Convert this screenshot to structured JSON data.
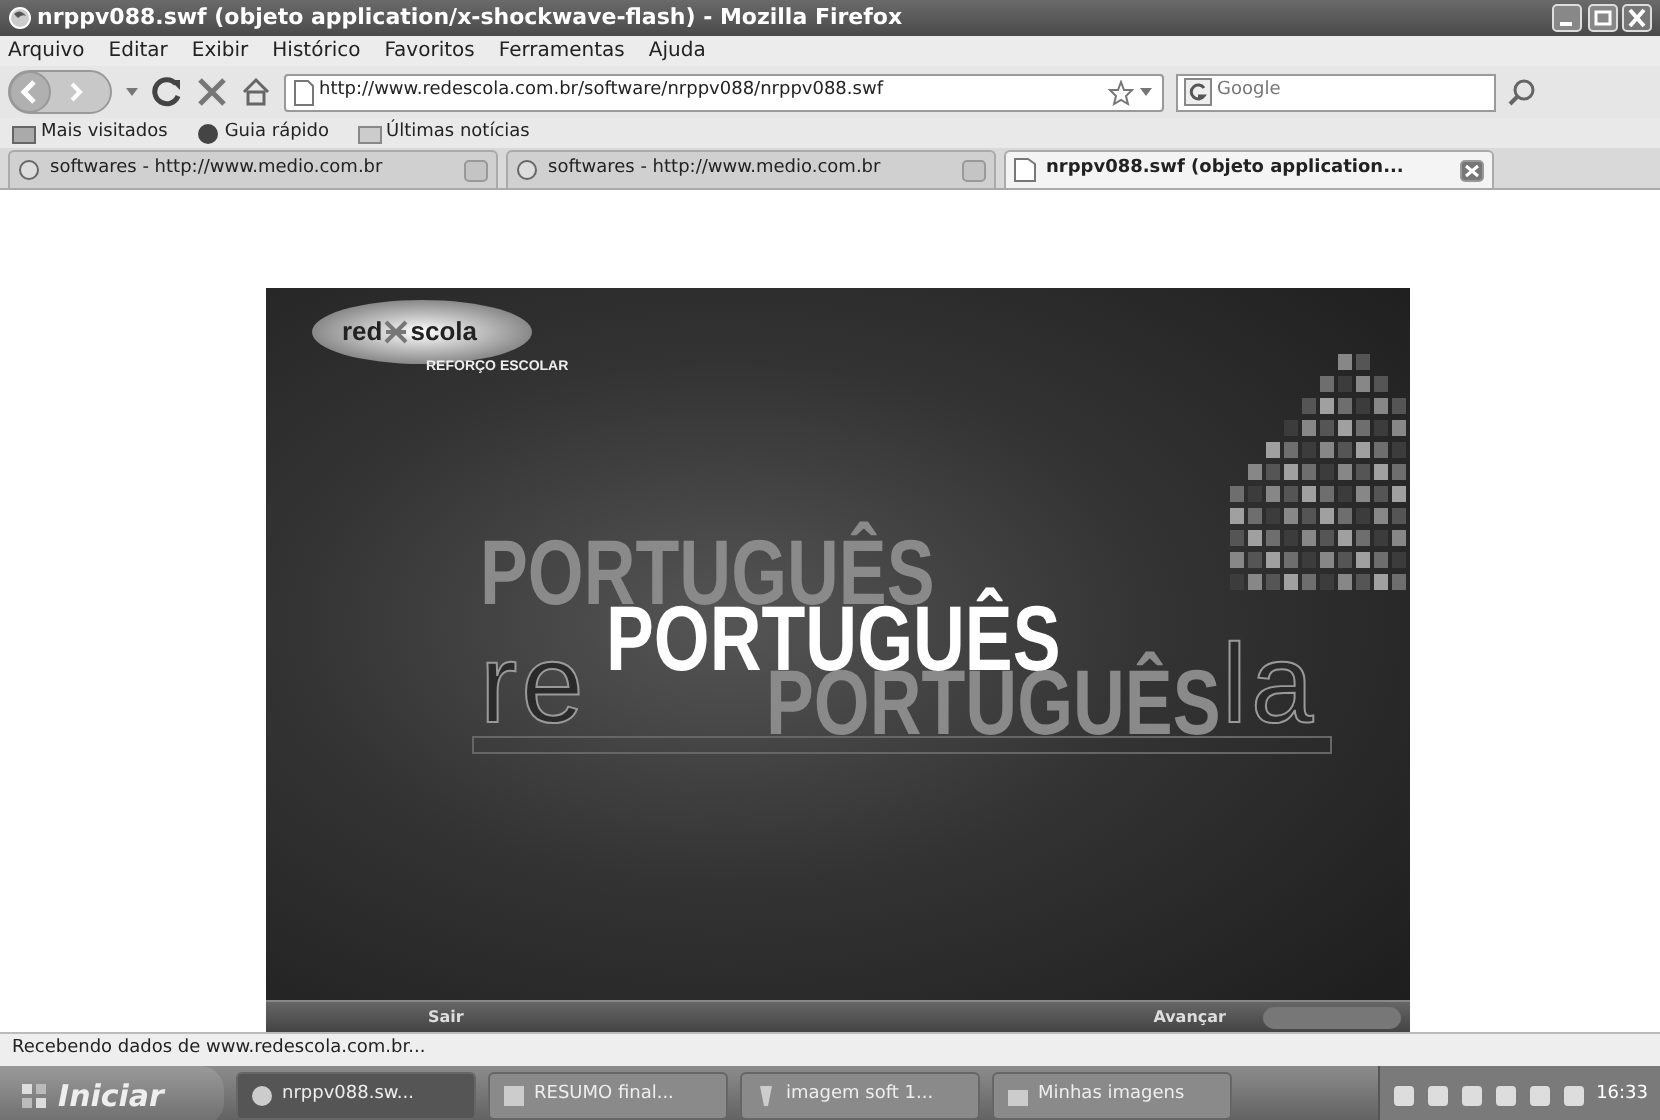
{
  "window": {
    "title": "nrppv088.swf (objeto application/x-shockwave-flash) - Mozilla Firefox"
  },
  "menu": [
    "Arquivo",
    "Editar",
    "Exibir",
    "Histórico",
    "Favoritos",
    "Ferramentas",
    "Ajuda"
  ],
  "address": {
    "value": "http://www.redescola.com.br/software/nrppv088/nrppv088.swf"
  },
  "search": {
    "placeholder": "Google"
  },
  "bookmarks": [
    "Mais visitados",
    "Guia rápido",
    "Últimas notícias"
  ],
  "tabs": [
    {
      "label": "softwares - http://www.medio.com.br",
      "selected": false
    },
    {
      "label": "softwares - http://www.medio.com.br",
      "selected": false
    },
    {
      "label": "nrppv088.swf (objeto application...",
      "selected": true
    }
  ],
  "flash": {
    "logo": {
      "left": "red",
      "right": "scola",
      "tagline": "REFORÇO ESCOLAR"
    },
    "titles": [
      {
        "text": "PORTUGUÊS",
        "kind": "upper"
      },
      {
        "text": "PORTUGUÊS",
        "kind": "lower"
      },
      {
        "text": "PORTUGUÊS",
        "kind": "main"
      }
    ],
    "outline_word_parts": [
      "re",
      "la"
    ],
    "buttons": [
      "Sair",
      "Avançar"
    ]
  },
  "status_bar": "Recebendo dados de www.redescola.com.br...",
  "taskbar": {
    "start": "Iniciar",
    "items": [
      {
        "label": "nrppv088.sw...",
        "selected": true
      },
      {
        "label": "RESUMO final...",
        "selected": false
      },
      {
        "label": "imagem soft 1...",
        "selected": false
      },
      {
        "label": "Minhas imagens",
        "selected": false
      }
    ],
    "clock": "16:33"
  }
}
